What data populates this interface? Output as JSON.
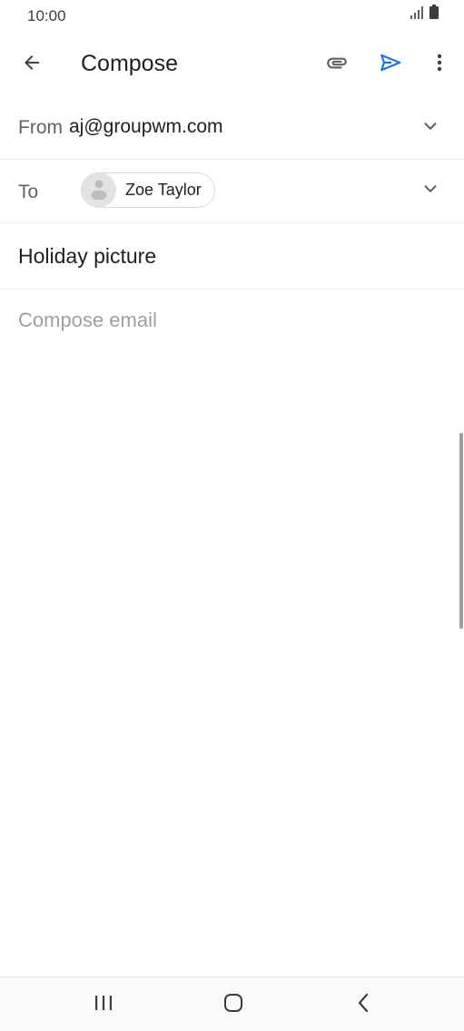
{
  "status_bar": {
    "time": "10:00",
    "signal_icon": "signal-icon",
    "battery_icon": "battery-icon"
  },
  "app_bar": {
    "title": "Compose",
    "back_icon": "back-arrow-icon",
    "attach_icon": "paperclip-icon",
    "send_icon": "send-icon",
    "more_icon": "more-vert-icon"
  },
  "from": {
    "label": "From",
    "value": "aj@groupwm.com"
  },
  "to": {
    "label": "To",
    "recipients": [
      {
        "name": "Zoe Taylor",
        "avatar_icon": "person-icon"
      }
    ]
  },
  "subject": {
    "value": "Holiday picture"
  },
  "body": {
    "placeholder": "Compose email",
    "value": ""
  },
  "nav_bar": {
    "recents_icon": "recents-icon",
    "home_icon": "home-icon",
    "back_icon": "nav-back-icon"
  },
  "colors": {
    "accent": "#1a73e8",
    "text_primary": "#202124",
    "text_secondary": "#5f6368",
    "placeholder": "#9aa0a6",
    "divider": "#ececec"
  }
}
